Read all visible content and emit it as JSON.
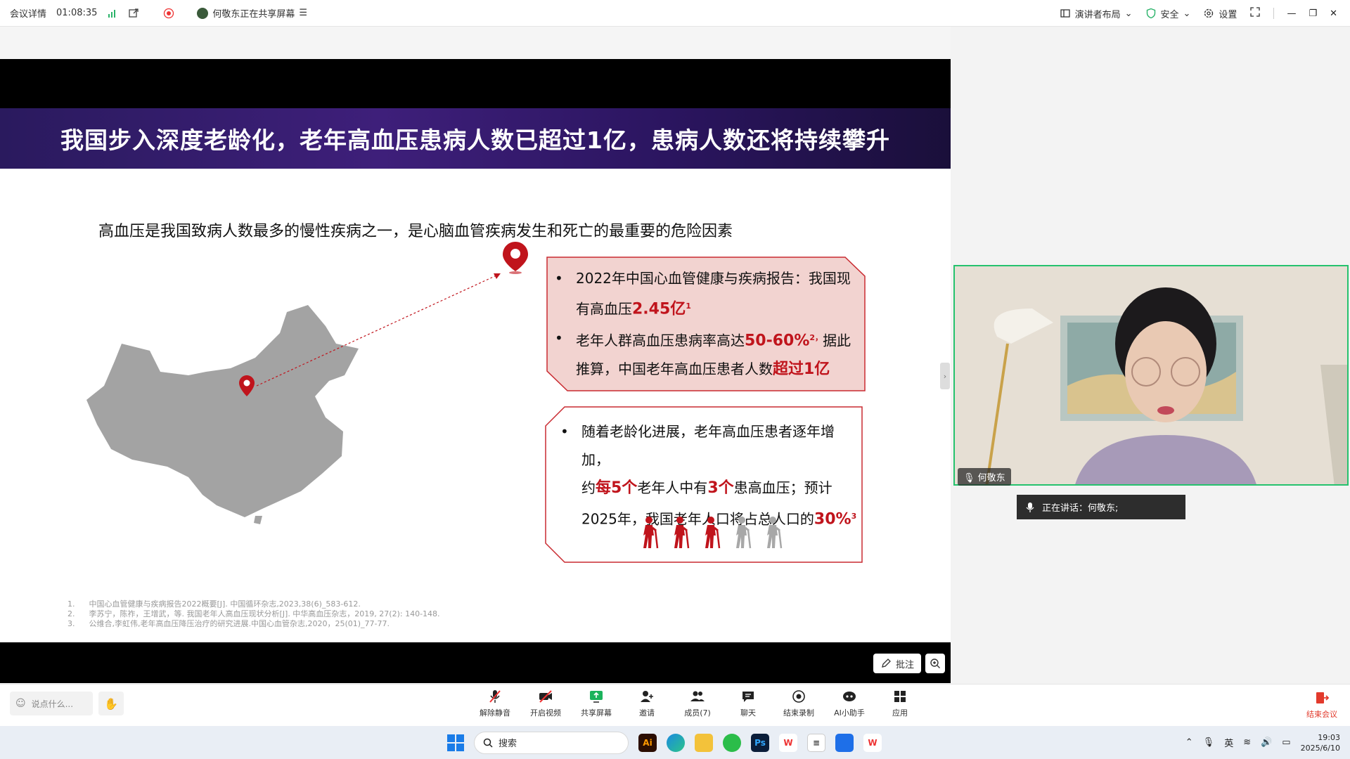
{
  "topbar": {
    "meeting_details": "会议详情",
    "duration": "01:08:35",
    "sharing_status": "何敬东正在共享屏幕",
    "layout": "演讲者布局",
    "security": "安全",
    "settings": "设置"
  },
  "slide": {
    "title": "我国步入深度老龄化，老年高血压患病人数已超过1亿，患病人数还将持续攀升",
    "subtitle": "高血压是我国致病人数最多的慢性疾病之一，是心脑血管疾病发生和死亡的最重要的危险因素",
    "box1": {
      "b1_text": "2022年中国心血管健康与疾病报告：我国现",
      "b1_text2": "有高血压",
      "b1_highlight": "2.45亿",
      "b1_sup": "1",
      "b2_text": "老年人群高血压患病率高达",
      "b2_highlight": "50-60%",
      "b2_sup": "2，",
      "b2_text2": "据此",
      "b2_text3": "推算，中国老年高血压患者人数",
      "b2_highlight2": "超过1亿"
    },
    "box2": {
      "text1": "随着老龄化进展，老年高血压患者逐年增加，",
      "text2a": "约",
      "hl1": "每5个",
      "text2b": "老年人中有",
      "hl2": "3个",
      "text2c": "患高血压；预计",
      "text3": "2025年，我国老年人口将占总人口的",
      "hl3": "30%",
      "sup": "3"
    },
    "references": [
      {
        "num": "1.",
        "text": "中国心血管健康与疾病报告2022概要[J]. 中国循环杂志,2023,38(6)_583-612."
      },
      {
        "num": "2.",
        "text": "李苏宁，陈祚，王增武，等. 我国老年人高血压现状分析[J]. 中华高血压杂志，2019, 27(2): 140-148."
      },
      {
        "num": "3.",
        "text": "公维合,李虹伟,老年高血压降压治疗的研究进展.中国心血管杂志,2020，25(01)_77-77."
      }
    ]
  },
  "annotate": {
    "label": "批注"
  },
  "video": {
    "participant": "何敬东"
  },
  "speaking_now": "正在讲话：何敬东;",
  "toolbar": {
    "chat_placeholder": "说点什么...",
    "tools": [
      "解除静音",
      "开启视频",
      "共享屏幕",
      "邀请",
      "成员(7)",
      "聊天",
      "结束录制",
      "AI小助手",
      "应用"
    ],
    "end": "结束会议"
  },
  "taskbar": {
    "search": "搜索",
    "lang": "英",
    "time": "19:03",
    "date": "2025/6/10"
  },
  "colors": {
    "accent": "#c0141c",
    "title_band": "#3e1f7a",
    "speaker_border": "#25c26e"
  }
}
